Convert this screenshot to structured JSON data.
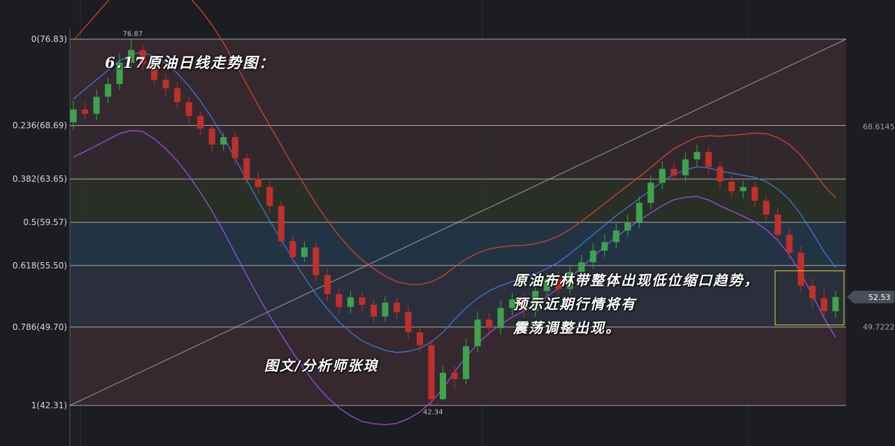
{
  "chart_data": {
    "type": "candlestick",
    "title": "6.17原油日线走势图：",
    "annotation_main": "原油布林带整体出现低位缩口趋势，预示近期行情将有震荡调整出现。",
    "annotation_lines": [
      "原油布林带整体出现低位缩口趋势，",
      "预示近期行情将有",
      "震荡调整出现。"
    ],
    "author": "图文/分析师张琅",
    "price_high": 76.87,
    "price_low": 42.34,
    "current_price": "52.53",
    "axis_labels_right": [
      "68.6145",
      "49.7222"
    ],
    "high_label": "76.87",
    "low_label": "42.34",
    "fibonacci_levels": [
      {
        "ratio": "0",
        "price": 76.83,
        "label": "0(76.83)"
      },
      {
        "ratio": "0.236",
        "price": 68.69,
        "label": "0.236(68.69)"
      },
      {
        "ratio": "0.382",
        "price": 63.65,
        "label": "0.382(63.65)"
      },
      {
        "ratio": "0.5",
        "price": 59.57,
        "label": "0.5(59.57)"
      },
      {
        "ratio": "0.618",
        "price": 55.5,
        "label": "0.618(55.50)"
      },
      {
        "ratio": "0.786",
        "price": 49.7,
        "label": "0.786(49.70)"
      },
      {
        "ratio": "1",
        "price": 42.31,
        "label": "1(42.31)"
      }
    ],
    "colors": {
      "bull": "#3fa34d",
      "bear": "#c0302b",
      "upper_band": "#d0452a",
      "middle_band": "#3b78d8",
      "lower_band": "#9b4fe0",
      "fib_line": "#c8c8c8",
      "highlight_box": "#e3d22a"
    },
    "midline": [
      71.2,
      72.1,
      73.0,
      73.9,
      74.8,
      75.4,
      75.6,
      75.2,
      74.5,
      73.6,
      72.4,
      71.0,
      69.4,
      67.6,
      65.6,
      63.6,
      61.6,
      59.7,
      57.9,
      56.1,
      54.4,
      52.8,
      51.4,
      50.2,
      49.2,
      48.4,
      47.9,
      47.5,
      47.3,
      47.4,
      47.7,
      48.3,
      49.2,
      50.4,
      51.5,
      52.4,
      53.1,
      53.6,
      54.0,
      54.3,
      54.7,
      55.2,
      55.8,
      56.6,
      57.5,
      58.4,
      59.3,
      60.2,
      61.0,
      61.8,
      62.6,
      63.4,
      64.1,
      64.5,
      64.8,
      64.7,
      64.4,
      64.2,
      64.0,
      63.8,
      63.4,
      62.7,
      61.7,
      60.3,
      58.6,
      56.8,
      55.3
    ],
    "candles": [
      [
        69.0,
        70.2,
        68.3,
        71.0
      ],
      [
        70.2,
        69.8,
        69.3,
        70.9
      ],
      [
        69.8,
        71.4,
        69.2,
        72.1
      ],
      [
        71.4,
        72.6,
        70.8,
        73.2
      ],
      [
        72.6,
        74.6,
        72.0,
        75.5
      ],
      [
        74.6,
        75.8,
        74.0,
        76.87
      ],
      [
        75.8,
        74.5,
        73.9,
        76.3
      ],
      [
        74.5,
        73.0,
        72.4,
        75.0
      ],
      [
        73.0,
        72.2,
        71.4,
        73.6
      ],
      [
        72.2,
        70.9,
        70.3,
        72.8
      ],
      [
        70.9,
        69.6,
        68.8,
        71.4
      ],
      [
        69.6,
        68.4,
        67.8,
        70.0
      ],
      [
        68.4,
        66.9,
        66.2,
        68.9
      ],
      [
        66.9,
        67.6,
        66.3,
        68.0
      ],
      [
        67.6,
        65.6,
        65.0,
        68.1
      ],
      [
        65.6,
        63.7,
        63.1,
        66.1
      ],
      [
        63.7,
        62.9,
        62.2,
        64.3
      ],
      [
        62.9,
        61.1,
        60.5,
        63.5
      ],
      [
        61.1,
        57.8,
        57.2,
        61.6
      ],
      [
        57.8,
        56.3,
        55.6,
        58.4
      ],
      [
        56.3,
        57.2,
        55.8,
        57.8
      ],
      [
        57.2,
        54.6,
        54.0,
        57.7
      ],
      [
        54.6,
        52.8,
        52.1,
        55.2
      ],
      [
        52.8,
        51.6,
        50.9,
        53.4
      ],
      [
        51.6,
        52.5,
        51.0,
        53.1
      ],
      [
        52.5,
        51.8,
        51.2,
        53.0
      ],
      [
        51.8,
        50.7,
        50.1,
        52.4
      ],
      [
        50.7,
        52.0,
        50.2,
        52.6
      ],
      [
        52.0,
        51.1,
        50.4,
        52.5
      ],
      [
        51.1,
        49.2,
        48.6,
        51.7
      ],
      [
        49.2,
        48.0,
        47.4,
        49.8
      ],
      [
        48.0,
        42.9,
        42.34,
        48.5
      ],
      [
        42.9,
        45.4,
        42.8,
        46.1
      ],
      [
        45.4,
        44.8,
        43.9,
        46.0
      ],
      [
        44.8,
        47.9,
        44.3,
        48.6
      ],
      [
        47.9,
        50.4,
        47.3,
        51.2
      ],
      [
        50.4,
        49.6,
        48.9,
        51.0
      ],
      [
        49.6,
        51.5,
        49.0,
        52.2
      ],
      [
        51.5,
        52.3,
        50.8,
        52.9
      ],
      [
        52.3,
        51.2,
        50.6,
        52.8
      ],
      [
        51.2,
        53.1,
        50.7,
        53.7
      ],
      [
        53.1,
        54.2,
        52.5,
        54.8
      ],
      [
        54.2,
        53.3,
        52.8,
        54.9
      ],
      [
        53.3,
        54.9,
        52.8,
        55.5
      ],
      [
        54.9,
        55.8,
        54.2,
        56.5
      ],
      [
        55.8,
        56.9,
        55.2,
        57.6
      ],
      [
        56.9,
        57.7,
        56.3,
        58.4
      ],
      [
        57.7,
        58.8,
        57.1,
        59.5
      ],
      [
        58.8,
        59.6,
        58.2,
        60.3
      ],
      [
        59.6,
        61.4,
        59.0,
        62.0
      ],
      [
        61.4,
        63.3,
        60.8,
        64.0
      ],
      [
        63.3,
        64.6,
        62.7,
        65.3
      ],
      [
        64.6,
        64.0,
        63.5,
        65.2
      ],
      [
        64.0,
        65.5,
        63.4,
        66.2
      ],
      [
        65.5,
        66.2,
        64.8,
        66.9
      ],
      [
        66.2,
        64.8,
        64.2,
        66.7
      ],
      [
        64.8,
        63.4,
        62.7,
        65.3
      ],
      [
        63.4,
        62.5,
        61.9,
        64.0
      ],
      [
        62.5,
        62.9,
        61.8,
        63.5
      ],
      [
        62.9,
        61.6,
        61.0,
        63.4
      ],
      [
        61.6,
        60.3,
        59.7,
        62.1
      ],
      [
        60.3,
        58.4,
        57.8,
        60.9
      ],
      [
        58.4,
        56.7,
        56.1,
        59.0
      ],
      [
        56.7,
        53.6,
        53.0,
        57.3
      ],
      [
        53.6,
        52.4,
        51.5,
        54.2
      ],
      [
        52.4,
        51.2,
        50.4,
        53.3
      ],
      [
        51.2,
        52.53,
        50.6,
        53.1
      ]
    ]
  },
  "legend_note": "",
  "colors": {
    "background": "#1c1d22"
  }
}
